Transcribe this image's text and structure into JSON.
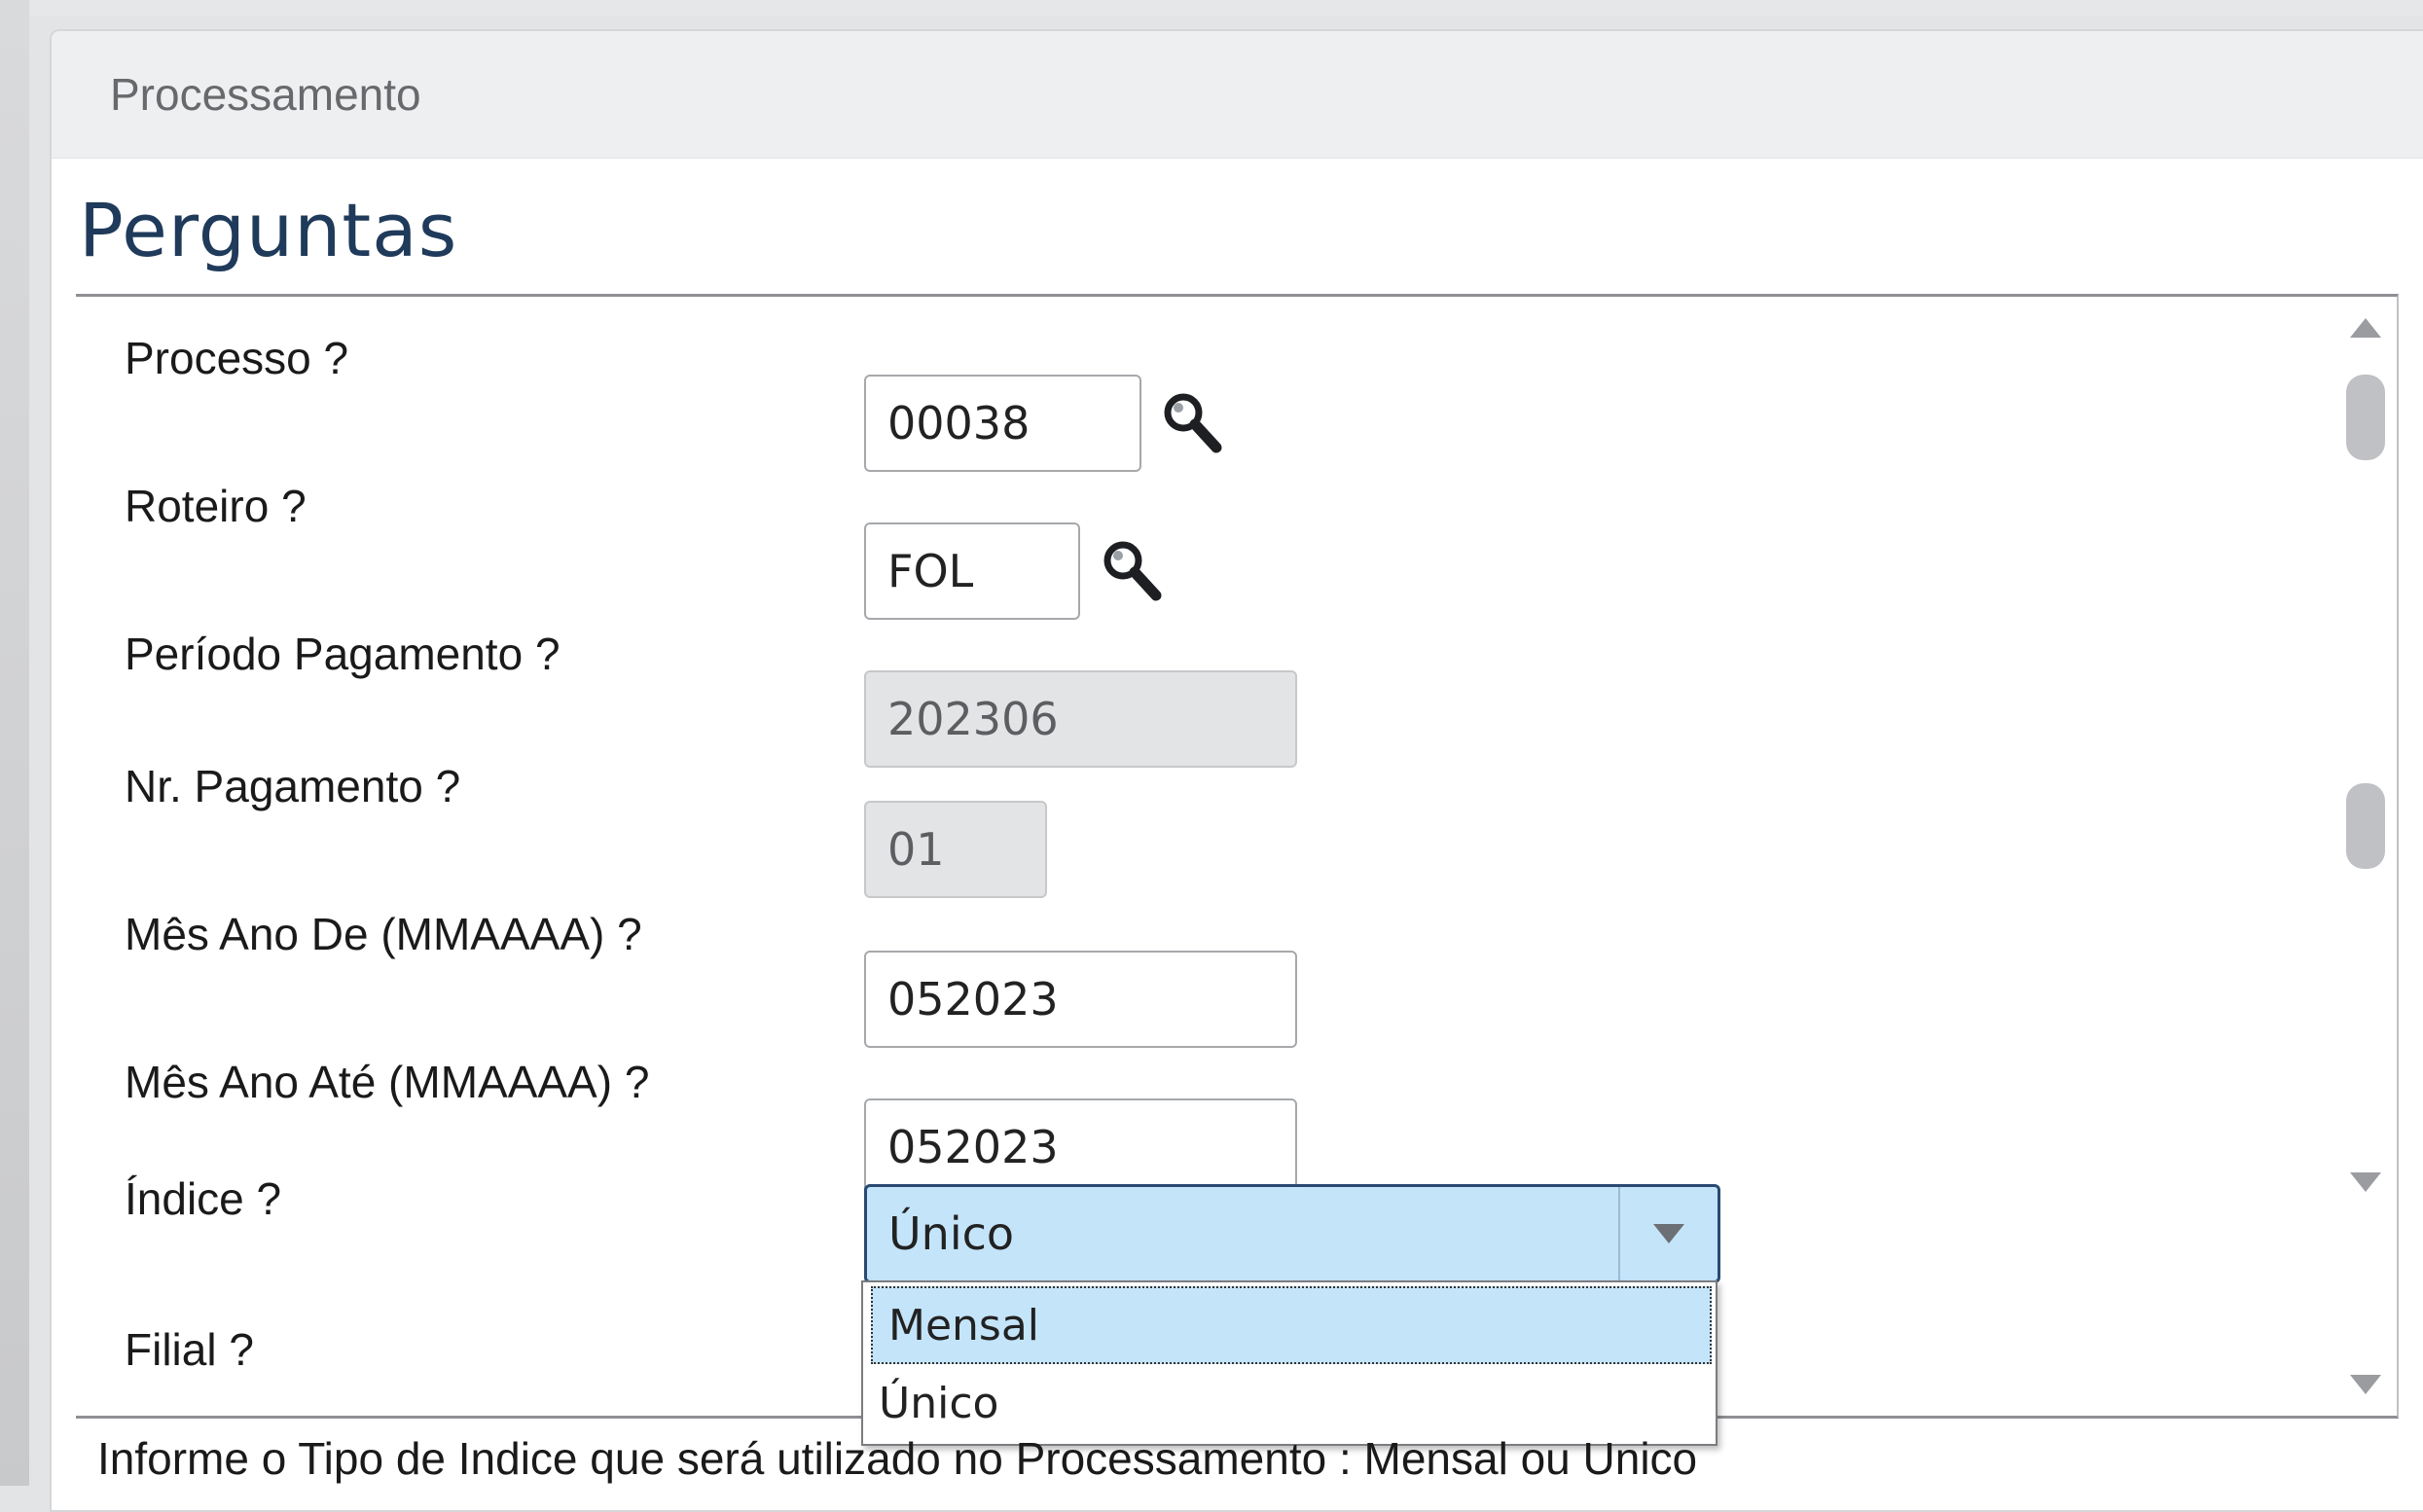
{
  "dialog": {
    "header_title": "Processamento",
    "section_title": "Perguntas"
  },
  "questions": [
    {
      "label": "Processo ?",
      "value": "00038",
      "disabled": false,
      "has_search": true
    },
    {
      "label": "Roteiro ?",
      "value": "FOL",
      "disabled": false,
      "has_search": true
    },
    {
      "label": "Período Pagamento ?",
      "value": "202306",
      "disabled": true,
      "has_search": false
    },
    {
      "label": "Nr. Pagamento ?",
      "value": "01",
      "disabled": true,
      "has_search": false
    },
    {
      "label": "Mês Ano De (MMAAAA) ?",
      "value": "052023",
      "disabled": false,
      "has_search": false
    },
    {
      "label": "Mês Ano Até (MMAAAA) ?",
      "value": "052023",
      "disabled": false,
      "has_search": false
    },
    {
      "label": "Índice ?",
      "value": "Único",
      "type": "select"
    },
    {
      "label": "Filial ?"
    }
  ],
  "indice_options": [
    "Mensal",
    "Único"
  ],
  "indice_highlighted": "Mensal",
  "hint": "Informe o Tipo de Indice que será utilizado no Processamento : Mensal ou Unico",
  "colors": {
    "title": "#1f3a5a",
    "select_bg": "#c4e4fa",
    "select_border": "#2a4a73"
  },
  "icons": {
    "search": "search-icon",
    "dropdown": "chevron-down-icon"
  }
}
